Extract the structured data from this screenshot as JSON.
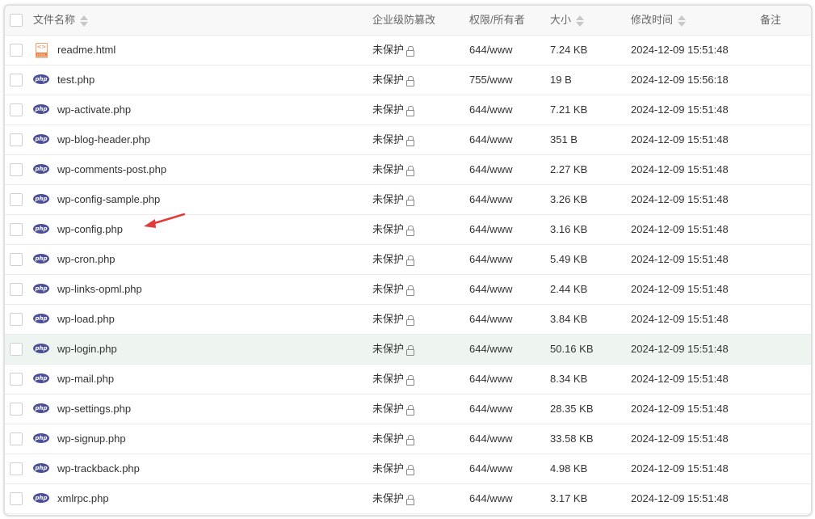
{
  "columns": {
    "name": "文件名称",
    "protect": "企业级防篡改",
    "perm": "权限/所有者",
    "size": "大小",
    "time": "修改时间",
    "note": "备注"
  },
  "protect_text": "未保护",
  "files": [
    {
      "name": "readme.html",
      "type": "html",
      "perm": "644/www",
      "size": "7.24 KB",
      "time": "2024-12-09 15:51:48"
    },
    {
      "name": "test.php",
      "type": "php",
      "perm": "755/www",
      "size": "19 B",
      "time": "2024-12-09 15:56:18"
    },
    {
      "name": "wp-activate.php",
      "type": "php",
      "perm": "644/www",
      "size": "7.21 KB",
      "time": "2024-12-09 15:51:48"
    },
    {
      "name": "wp-blog-header.php",
      "type": "php",
      "perm": "644/www",
      "size": "351 B",
      "time": "2024-12-09 15:51:48"
    },
    {
      "name": "wp-comments-post.php",
      "type": "php",
      "perm": "644/www",
      "size": "2.27 KB",
      "time": "2024-12-09 15:51:48"
    },
    {
      "name": "wp-config-sample.php",
      "type": "php",
      "perm": "644/www",
      "size": "3.26 KB",
      "time": "2024-12-09 15:51:48"
    },
    {
      "name": "wp-config.php",
      "type": "php",
      "perm": "644/www",
      "size": "3.16 KB",
      "time": "2024-12-09 15:51:48"
    },
    {
      "name": "wp-cron.php",
      "type": "php",
      "perm": "644/www",
      "size": "5.49 KB",
      "time": "2024-12-09 15:51:48"
    },
    {
      "name": "wp-links-opml.php",
      "type": "php",
      "perm": "644/www",
      "size": "2.44 KB",
      "time": "2024-12-09 15:51:48"
    },
    {
      "name": "wp-load.php",
      "type": "php",
      "perm": "644/www",
      "size": "3.84 KB",
      "time": "2024-12-09 15:51:48"
    },
    {
      "name": "wp-login.php",
      "type": "php",
      "perm": "644/www",
      "size": "50.16 KB",
      "time": "2024-12-09 15:51:48"
    },
    {
      "name": "wp-mail.php",
      "type": "php",
      "perm": "644/www",
      "size": "8.34 KB",
      "time": "2024-12-09 15:51:48"
    },
    {
      "name": "wp-settings.php",
      "type": "php",
      "perm": "644/www",
      "size": "28.35 KB",
      "time": "2024-12-09 15:51:48"
    },
    {
      "name": "wp-signup.php",
      "type": "php",
      "perm": "644/www",
      "size": "33.58 KB",
      "time": "2024-12-09 15:51:48"
    },
    {
      "name": "wp-trackback.php",
      "type": "php",
      "perm": "644/www",
      "size": "4.98 KB",
      "time": "2024-12-09 15:51:48"
    },
    {
      "name": "xmlrpc.php",
      "type": "php",
      "perm": "644/www",
      "size": "3.17 KB",
      "time": "2024-12-09 15:51:48"
    }
  ],
  "highlighted_row": 10,
  "icons": {
    "php_label": "php",
    "html_label": "HTML",
    "html_glyph": "<>"
  },
  "colors": {
    "php_icon": "#4b4f98",
    "arrow": "#e03c3c",
    "highlight_row": "#eef5f1"
  }
}
